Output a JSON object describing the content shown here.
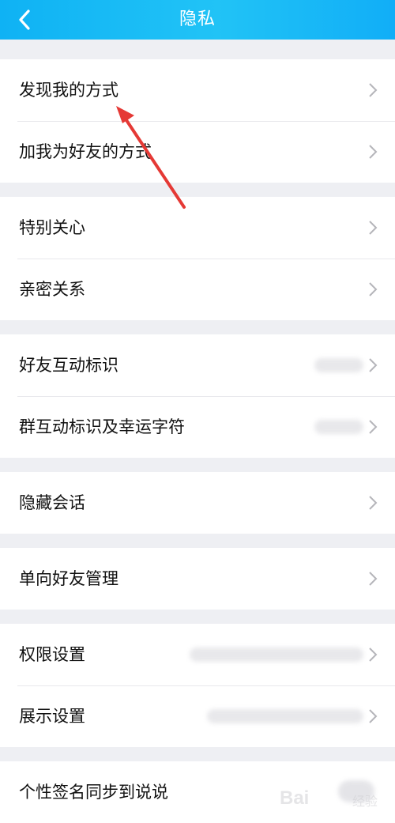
{
  "header": {
    "title": "隐私",
    "accent": "#12b7f5"
  },
  "groups": [
    {
      "items": [
        "发现我的方式",
        "加我为好友的方式"
      ]
    },
    {
      "items": [
        "特别关心",
        "亲密关系"
      ]
    },
    {
      "items": [
        "好友互动标识",
        "群互动标识及幸运字符"
      ]
    },
    {
      "items": [
        "隐藏会话"
      ]
    },
    {
      "items": [
        "单向好友管理"
      ]
    },
    {
      "items": [
        "权限设置",
        "展示设置"
      ]
    },
    {
      "items": [
        "个性签名同步到说说"
      ]
    }
  ],
  "annotation": {
    "color": "#e53935"
  },
  "watermark": {
    "brand": "Bai",
    "sub": "经验"
  }
}
